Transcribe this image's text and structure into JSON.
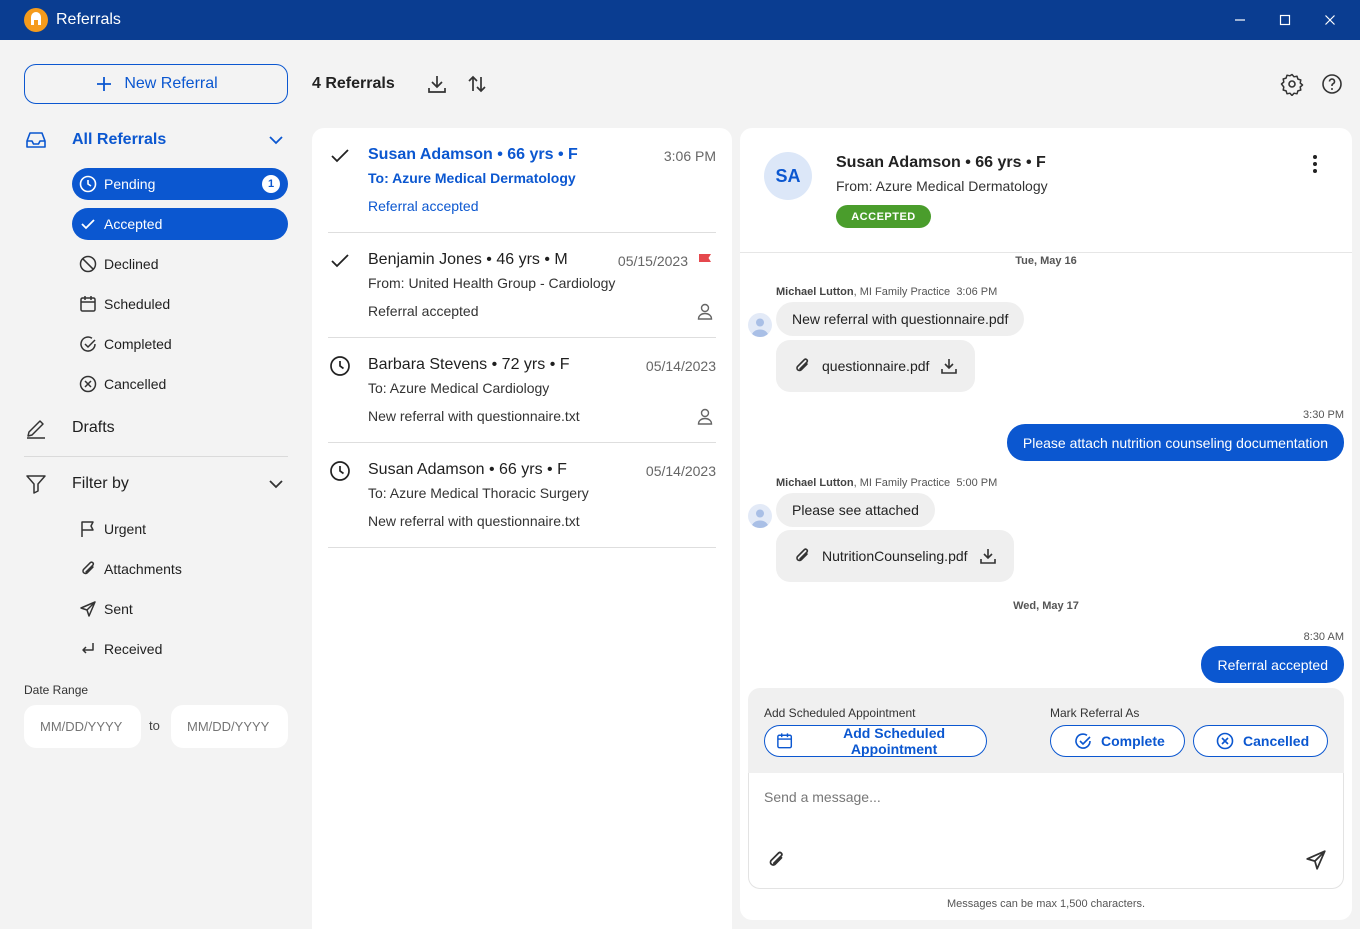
{
  "app": {
    "title": "Referrals",
    "logo_icon": "app-logo-icon"
  },
  "sidebar": {
    "new_referral_label": "New Referral",
    "all_referrals_label": "All Referrals",
    "status_items": [
      {
        "label": "Pending",
        "badge": "1",
        "active": true,
        "icon": "clock-icon"
      },
      {
        "label": "Accepted",
        "active": true,
        "icon": "check-icon"
      },
      {
        "label": "Declined",
        "icon": "block-icon"
      },
      {
        "label": "Scheduled",
        "icon": "calendar-icon"
      },
      {
        "label": "Completed",
        "icon": "check-circle-icon"
      },
      {
        "label": "Cancelled",
        "icon": "x-circle-icon"
      }
    ],
    "drafts_label": "Drafts",
    "filter_label": "Filter by",
    "filter_items": [
      {
        "label": "Urgent",
        "icon": "flag-icon"
      },
      {
        "label": "Attachments",
        "icon": "paperclip-icon"
      },
      {
        "label": "Sent",
        "icon": "send-icon"
      },
      {
        "label": "Received",
        "icon": "return-icon"
      }
    ],
    "date_range": {
      "label": "Date Range",
      "from_placeholder": "MM/DD/YYYY",
      "to_placeholder": "MM/DD/YYYY",
      "to_label": "to"
    }
  },
  "toolbar": {
    "count_label": "4 Referrals"
  },
  "referrals": [
    {
      "name": "Susan Adamson  •  66 yrs  •  F",
      "route": "To: Azure Medical Dermatology",
      "message": "Referral accepted",
      "time": "3:06 PM",
      "status": "accepted",
      "highlight": true
    },
    {
      "name": "Benjamin Jones  •  46 yrs  •  M",
      "route": "From: United Health Group - Cardiology",
      "message": "Referral accepted",
      "time": "05/15/2023",
      "status": "accepted",
      "flagged": true,
      "assignee_icon": true
    },
    {
      "name": "Barbara Stevens  •  72 yrs  •  F",
      "route": "To: Azure Medical Cardiology",
      "message": "New referral with questionnaire.txt",
      "time": "05/14/2023",
      "status": "pending",
      "assignee_icon": true
    },
    {
      "name": "Susan Adamson  •  66 yrs  •  F",
      "route": "To: Azure Medical Thoracic Surgery",
      "message": "New referral with questionnaire.txt",
      "time": "05/14/2023",
      "status": "pending"
    }
  ],
  "detail": {
    "initials": "SA",
    "name": "Susan Adamson  •  66 yrs  •  F",
    "from": "From: Azure Medical Dermatology",
    "status": "ACCEPTED",
    "status_color": "#4a9d2c",
    "conversation": {
      "day1": "Tue, May 16",
      "msg1_sender": "Michael Lutton",
      "msg1_org": ", MI Family Practice",
      "msg1_time": "3:06 PM",
      "msg1_text": "New referral with questionnaire.pdf",
      "msg1_file": "questionnaire.pdf",
      "out1_time": "3:30 PM",
      "out1_text": "Please attach nutrition counseling documentation",
      "msg2_sender": "Michael Lutton",
      "msg2_org": ", MI Family Practice",
      "msg2_time": "5:00 PM",
      "msg2_text": "Please see attached",
      "msg2_file": "NutritionCounseling.pdf",
      "day2": "Wed, May 17",
      "out2_time": "8:30 AM",
      "out2_text": "Referral accepted"
    },
    "actions": {
      "appointment_label": "Add Scheduled Appointment",
      "appointment_button": "Add Scheduled Appointment",
      "mark_label": "Mark Referral As",
      "complete_button": "Complete",
      "cancelled_button": "Cancelled"
    },
    "composer": {
      "placeholder": "Send a message...",
      "limit_note": "Messages can be max 1,500 characters."
    }
  },
  "colors": {
    "primary": "#0b57d0",
    "titlebar": "#0a3d91",
    "accepted": "#4a9d2c",
    "flag": "#e5484d"
  }
}
